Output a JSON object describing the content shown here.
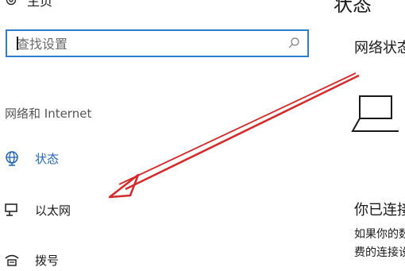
{
  "sidebar": {
    "home_label": "主页",
    "search": {
      "placeholder": "查找设置",
      "value": ""
    },
    "section_label": "网络和 Internet",
    "items": [
      {
        "label": "状态",
        "icon": "globe-icon",
        "active": true
      },
      {
        "label": "以太网",
        "icon": "ethernet-icon"
      },
      {
        "label": "拨号",
        "icon": "dialup-icon"
      }
    ]
  },
  "main": {
    "title": "状态",
    "network_status": "网络状态",
    "connected_text": "你已连接到 Internet",
    "info_line1": "如果你的数据流量套餐有限制",
    "info_line2": "费的连接设置为按流量计费"
  },
  "colors": {
    "accent": "#2065b8",
    "search_border": "#2e7fd0",
    "annotation": "#d42a2a"
  }
}
